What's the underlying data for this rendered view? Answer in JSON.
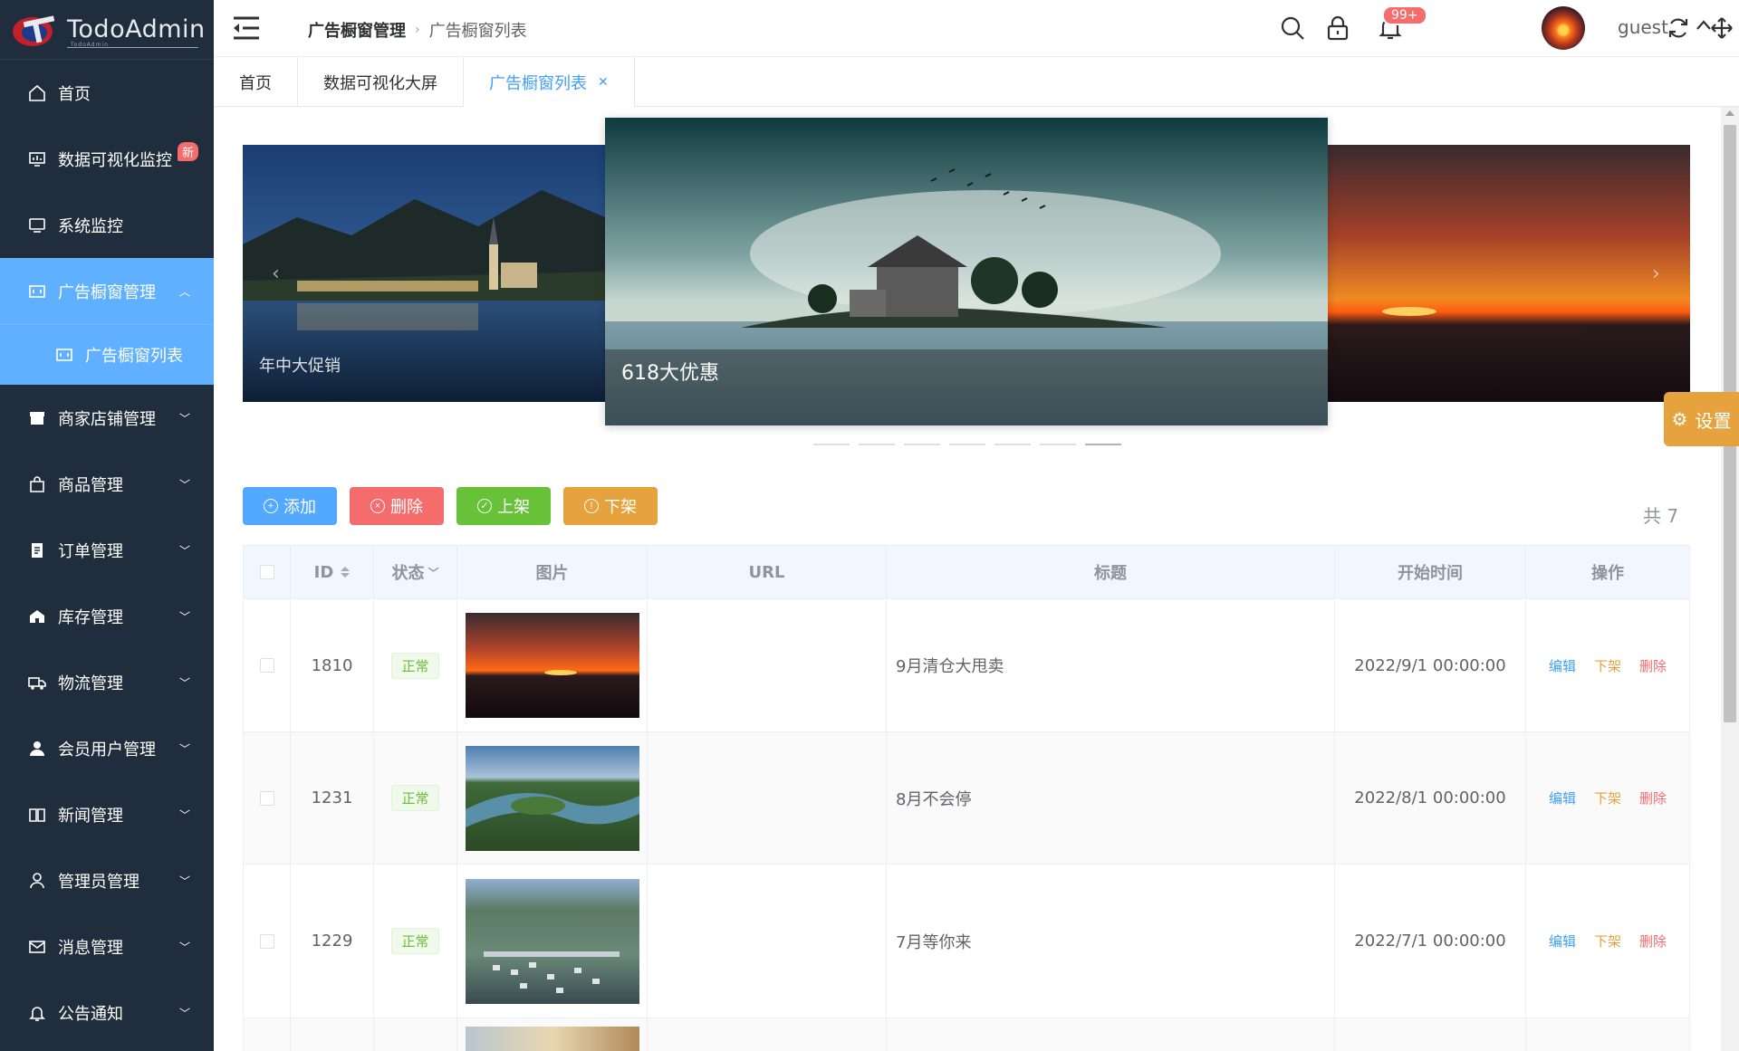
{
  "app": {
    "logo_text": "TodoAdmin",
    "logo_sub": "TodoAdmin"
  },
  "sidebar": {
    "items": [
      {
        "label": "首页",
        "icon": "home-icon"
      },
      {
        "label": "数据可视化监控",
        "icon": "dashboard-icon",
        "badge": "新"
      },
      {
        "label": "系统监控",
        "icon": "monitor-icon"
      },
      {
        "label": "广告橱窗管理",
        "icon": "ad-window-icon",
        "active": true
      },
      {
        "label": "商家店铺管理",
        "icon": "shop-icon"
      },
      {
        "label": "商品管理",
        "icon": "bag-icon"
      },
      {
        "label": "订单管理",
        "icon": "order-icon"
      },
      {
        "label": "库存管理",
        "icon": "warehouse-icon"
      },
      {
        "label": "物流管理",
        "icon": "truck-icon"
      },
      {
        "label": "会员用户管理",
        "icon": "user-icon"
      },
      {
        "label": "新闻管理",
        "icon": "book-icon"
      },
      {
        "label": "管理员管理",
        "icon": "admin-icon"
      },
      {
        "label": "消息管理",
        "icon": "mail-icon"
      },
      {
        "label": "公告通知",
        "icon": "bell-icon"
      }
    ],
    "sub_item": "广告橱窗列表"
  },
  "header": {
    "breadcrumb": [
      "广告橱窗管理",
      "广告橱窗列表"
    ],
    "notification_count": "99+",
    "username": "guest"
  },
  "tabs": [
    {
      "label": "首页"
    },
    {
      "label": "数据可视化大屏"
    },
    {
      "label": "广告橱窗列表",
      "active": true
    }
  ],
  "carousel": {
    "captions": [
      "年中大促销",
      "618大优惠"
    ],
    "indicator_count": 7,
    "active_indicator": 7
  },
  "settings_label": "设置",
  "toolbar": {
    "add": "添加",
    "delete": "删除",
    "online": "上架",
    "offline": "下架",
    "total": "共 7"
  },
  "table": {
    "columns": [
      "ID",
      "状态",
      "图片",
      "URL",
      "标题",
      "开始时间",
      "操作"
    ],
    "rows": [
      {
        "id": "1810",
        "status": "正常",
        "url": "",
        "title": "9月清仓大甩卖",
        "start": "2022/9/1 00:00:00"
      },
      {
        "id": "1231",
        "status": "正常",
        "url": "",
        "title": "8月不会停",
        "start": "2022/8/1 00:00:00"
      },
      {
        "id": "1229",
        "status": "正常",
        "url": "",
        "title": "7月等你来",
        "start": "2022/7/1 00:00:00"
      }
    ],
    "actions": {
      "edit": "编辑",
      "offline": "下架",
      "delete": "删除"
    }
  },
  "colors": {
    "sidebar_bg": "#1f2d3d",
    "active_blue": "#5fb0ff",
    "primary": "#409eff",
    "danger": "#f56c6c",
    "success": "#67c23a",
    "warning": "#e6a23c"
  }
}
